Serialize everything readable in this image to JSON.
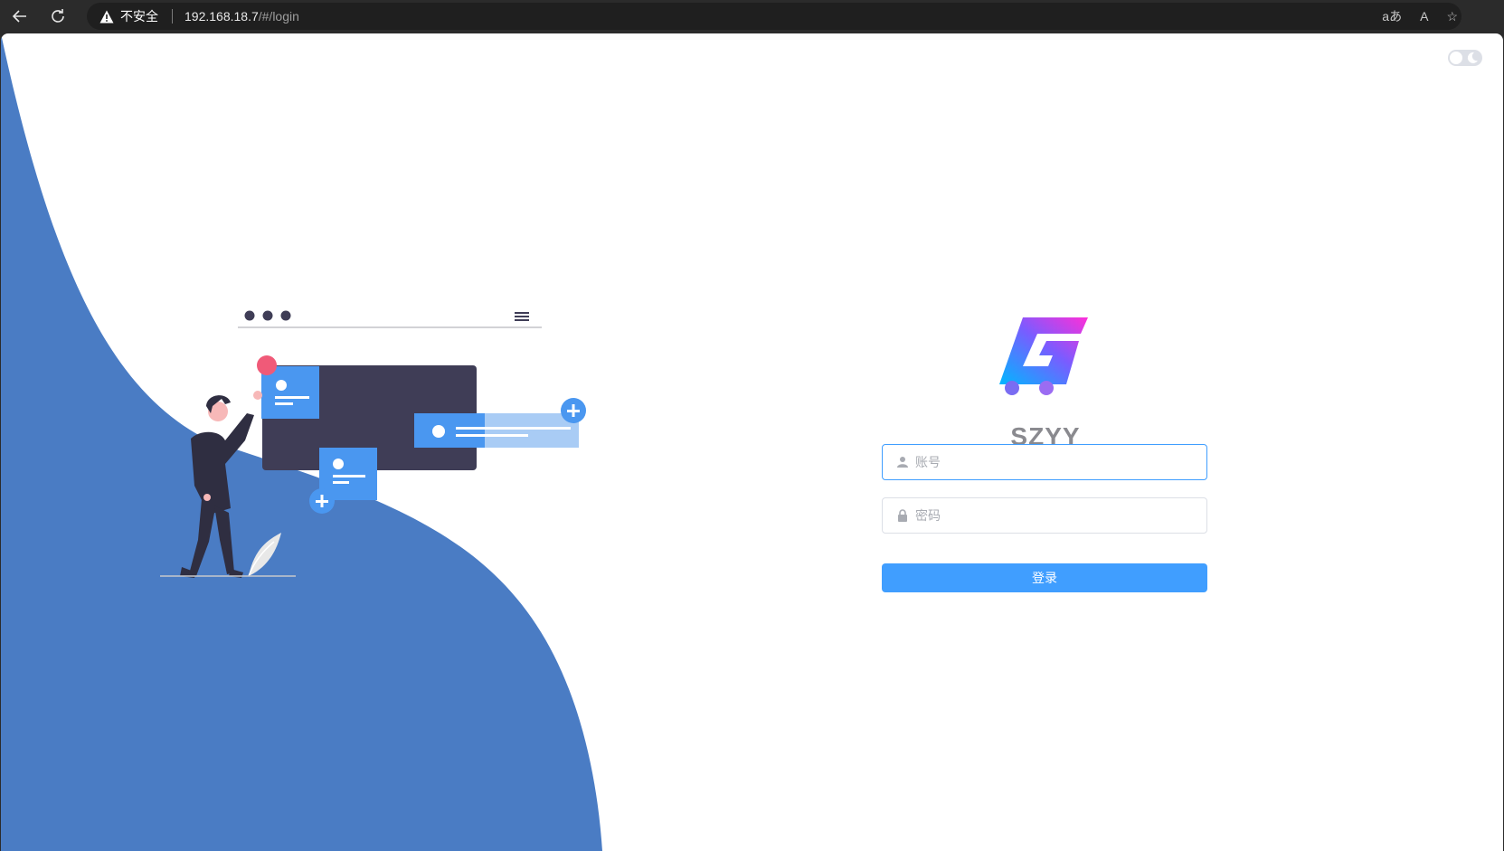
{
  "browser": {
    "security_label": "不安全",
    "url_host": "192.168.18.7",
    "url_path": "/#/login",
    "translate_glyph": "aあ",
    "read_aloud_glyph": "A",
    "favorite_glyph": "☆"
  },
  "login": {
    "brand": "SZYY",
    "username_placeholder": "账号",
    "password_placeholder": "密码",
    "submit_label": "登录"
  },
  "colors": {
    "primary": "#409eff",
    "wave": "#4a7cc4",
    "illustration_dark": "#3f3d56",
    "card_blue": "#4a97f0"
  }
}
